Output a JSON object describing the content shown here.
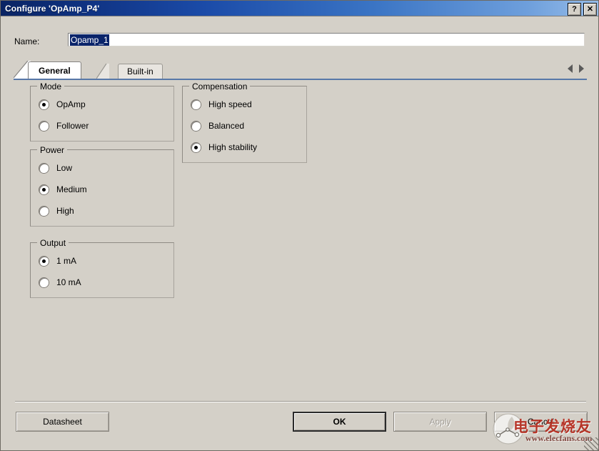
{
  "window": {
    "title": "Configure 'OpAmp_P4'",
    "help_button": "?",
    "close_button": "✕"
  },
  "name_field": {
    "label": "Name:",
    "value": "Opamp_1",
    "placeholder": ""
  },
  "tabs": {
    "items": [
      {
        "label": "General",
        "active": true
      },
      {
        "label": "Built-in",
        "active": false
      }
    ],
    "scroll_prev": "◁",
    "scroll_next": "▷"
  },
  "groups": {
    "mode": {
      "title": "Mode",
      "options": [
        {
          "label": "OpAmp",
          "selected": true
        },
        {
          "label": "Follower",
          "selected": false
        }
      ]
    },
    "power": {
      "title": "Power",
      "options": [
        {
          "label": "Low",
          "selected": false
        },
        {
          "label": "Medium",
          "selected": true
        },
        {
          "label": "High",
          "selected": false
        }
      ]
    },
    "output": {
      "title": "Output",
      "options": [
        {
          "label": "1 mA",
          "selected": true
        },
        {
          "label": "10 mA",
          "selected": false
        }
      ]
    },
    "compensation": {
      "title": "Compensation",
      "options": [
        {
          "label": "High speed",
          "selected": false
        },
        {
          "label": "Balanced",
          "selected": false
        },
        {
          "label": "High stability",
          "selected": true
        }
      ]
    }
  },
  "footer": {
    "datasheet": "Datasheet",
    "ok": "OK",
    "apply": "Apply",
    "cancel": "Cancel"
  },
  "watermark": {
    "chinese": "电子发烧友",
    "url": "www.elecfans.com"
  },
  "colors": {
    "title_bar_start": "#0a2463",
    "title_bar_end": "#97bde9",
    "dialog_face": "#d4d0c8",
    "selection": "#0a246a",
    "tab_underline": "#5878a8",
    "watermark_red": "#b52a1c"
  }
}
